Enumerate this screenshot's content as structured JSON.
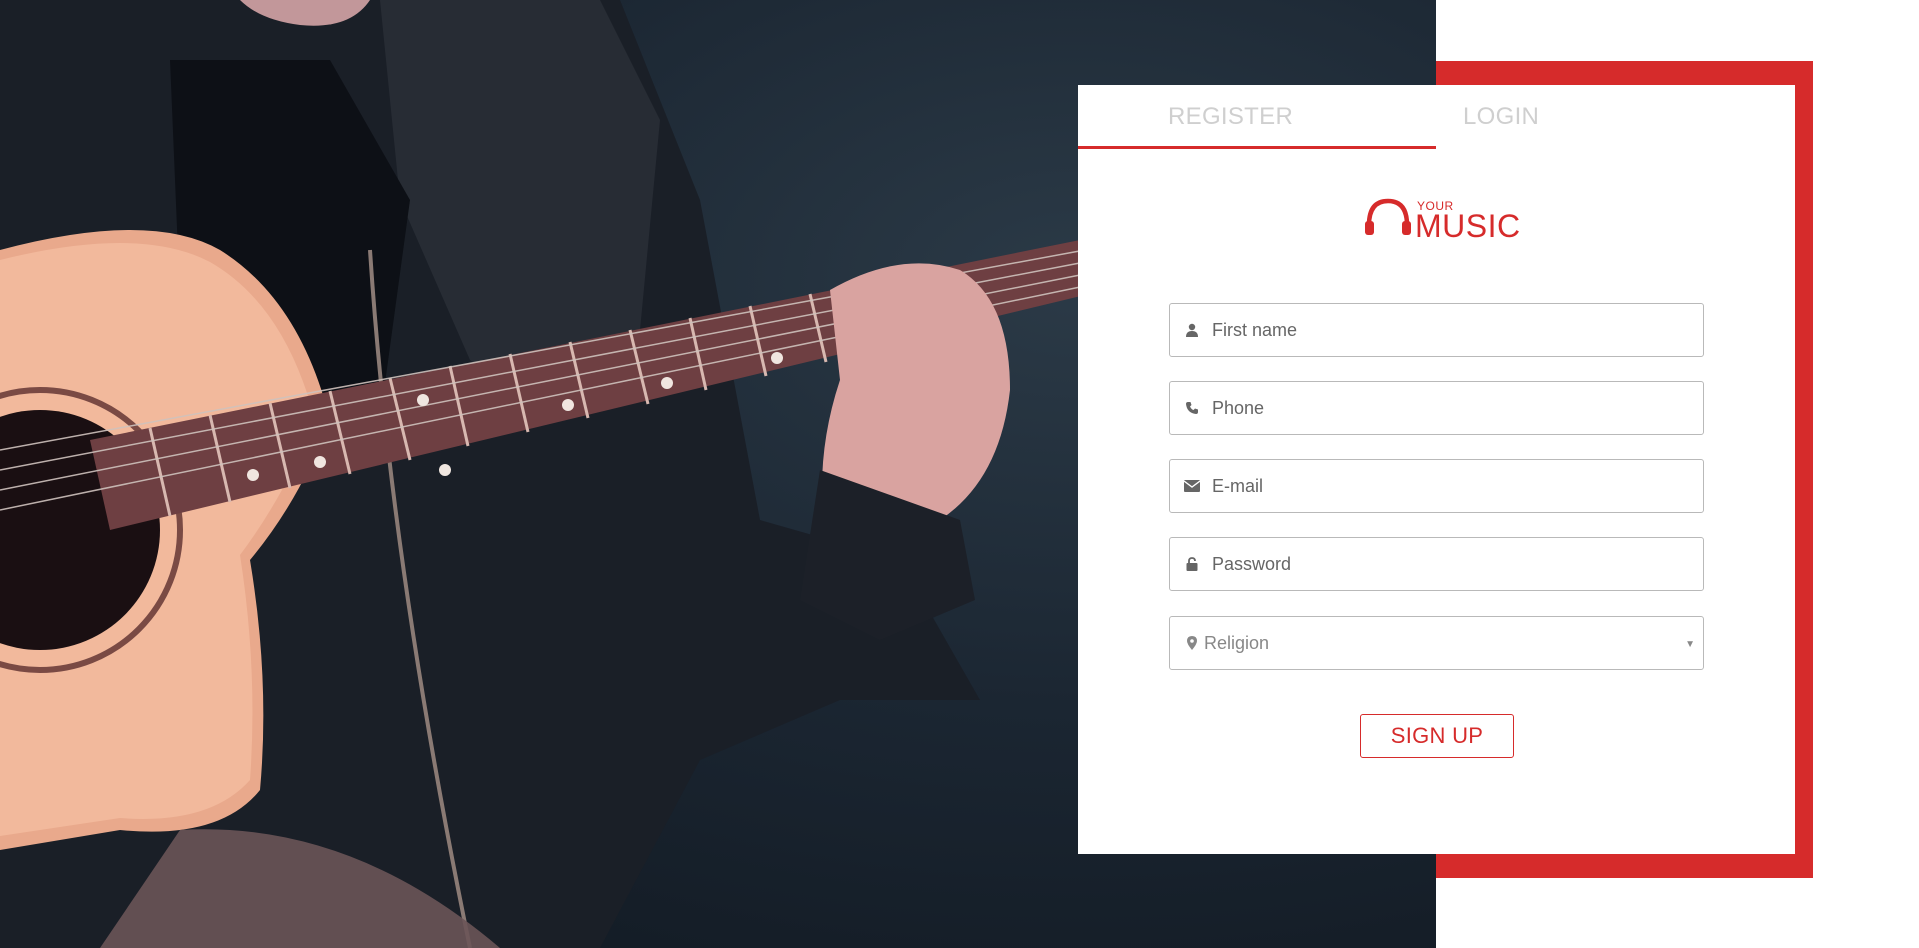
{
  "tabs": [
    {
      "label": "REGISTER",
      "active": true
    },
    {
      "label": "LOGIN",
      "active": false
    }
  ],
  "logo": {
    "small": "YOUR",
    "big": "MUSIC",
    "icon": "headphones-icon"
  },
  "form": {
    "first_name": {
      "placeholder": "First name",
      "icon": "user-icon"
    },
    "phone": {
      "placeholder": "Phone",
      "icon": "phone-icon"
    },
    "email": {
      "placeholder": "E-mail",
      "icon": "envelope-icon"
    },
    "password": {
      "placeholder": "Password",
      "icon": "lock-icon"
    },
    "religion": {
      "selected": "Religion",
      "icon": "map-marker-icon"
    }
  },
  "signup_label": "SIGN UP",
  "colors": {
    "accent": "#d62b2b",
    "frame": "#d62b2b",
    "tab_inactive": "#cfcfcf"
  }
}
